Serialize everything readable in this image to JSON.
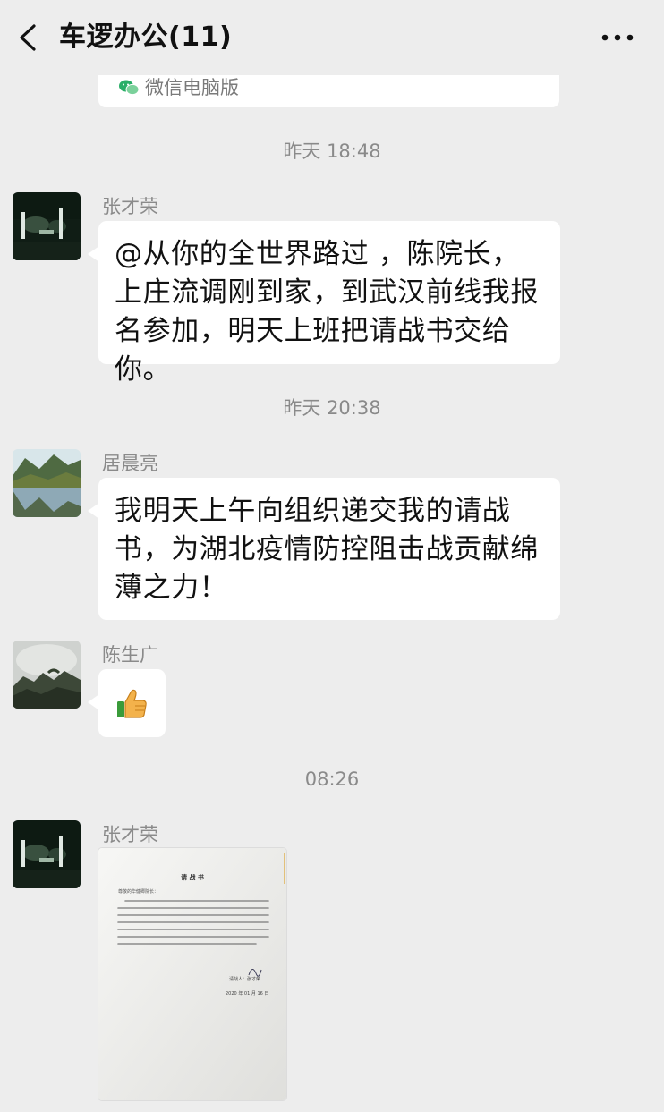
{
  "header": {
    "title": "车逻办公(11)"
  },
  "pinned_card": {
    "label": "微信电脑版"
  },
  "messages": [
    {
      "timestamp": "昨天 18:48"
    },
    {
      "sender": "张才荣",
      "text": "@从你的全世界路过 ，陈院长，上庄流调刚到家，到武汉前线我报名参加，明天上班把请战书交给你。"
    },
    {
      "timestamp": "昨天 20:38"
    },
    {
      "sender": "居晨亮",
      "text": "我明天上午向组织递交我的请战书，为湖北疫情防控阻击战贡献绵薄之力！"
    },
    {
      "sender": "陈生广",
      "emoji": "thumbs-up-icon"
    },
    {
      "timestamp": "08:26"
    },
    {
      "sender": "张才荣",
      "image": "document-photo"
    }
  ],
  "document_photo": {
    "title": "请 战 书",
    "greeting": "尊敬的华健卿院长：",
    "signature": "请战人：张才荣",
    "date": "2020 年 01 月 16 日"
  },
  "colors": {
    "background": "#ededed",
    "bubble": "#ffffff",
    "meta_text": "#8a8a8a",
    "wechat_green": "#2aae67"
  }
}
